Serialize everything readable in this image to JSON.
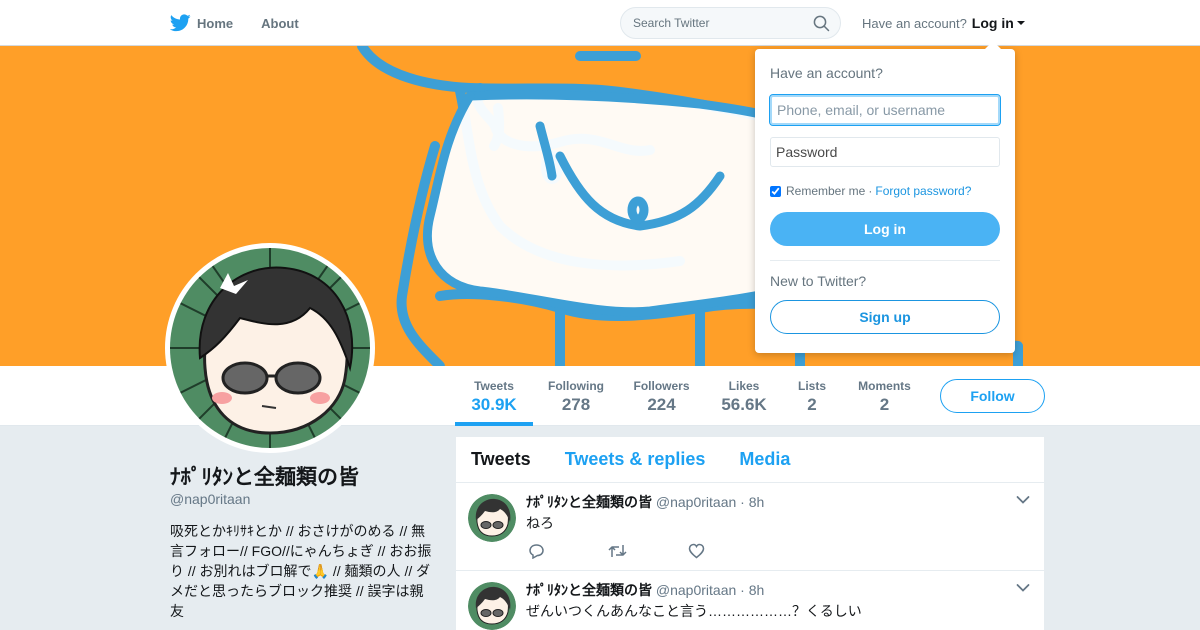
{
  "nav": {
    "home_label": "Home",
    "about_label": "About",
    "search_placeholder": "Search Twitter",
    "have_account_text": "Have an account?",
    "login_label": "Log in"
  },
  "profile": {
    "name": "ﾅﾎﾟﾘﾀﾝと全麺類の皆",
    "handle": "@nap0ritaan",
    "bio": "吸死とかｷﾘｻｷとか // おさけがのめる // 無言フォロー// FGO//にゃんちょぎ // おお振り // お別れはブロ解で🙏 // 麺類の人 // ダメだと思ったらブロック推奨 // 誤字は親友"
  },
  "stats": [
    {
      "label": "Tweets",
      "value": "30.9K"
    },
    {
      "label": "Following",
      "value": "278"
    },
    {
      "label": "Followers",
      "value": "224"
    },
    {
      "label": "Likes",
      "value": "56.6K"
    },
    {
      "label": "Lists",
      "value": "2"
    },
    {
      "label": "Moments",
      "value": "2"
    }
  ],
  "follow_label": "Follow",
  "tabs": [
    "Tweets",
    "Tweets & replies",
    "Media"
  ],
  "tweets": [
    {
      "name": "ﾅﾎﾟﾘﾀﾝと全麺類の皆",
      "handle": "@nap0ritaan",
      "time": "· 8h",
      "text": "ねろ"
    },
    {
      "name": "ﾅﾎﾟﾘﾀﾝと全麺類の皆",
      "handle": "@nap0ritaan",
      "time": "· 8h",
      "text": "ぜんいつくんあんなこと言う………………？くるしい"
    }
  ],
  "login_dropdown": {
    "title": "Have an account?",
    "username_placeholder": "Phone, email, or username",
    "password_placeholder": "Password",
    "remember_label": "Remember me",
    "separator": "·",
    "forgot_label": "Forgot password?",
    "login_button": "Log in",
    "new_text": "New to Twitter?",
    "signup_button": "Sign up"
  },
  "colors": {
    "accent": "#1da1f2",
    "banner": "#ff9f28",
    "login_button": "#4ab3f4"
  }
}
